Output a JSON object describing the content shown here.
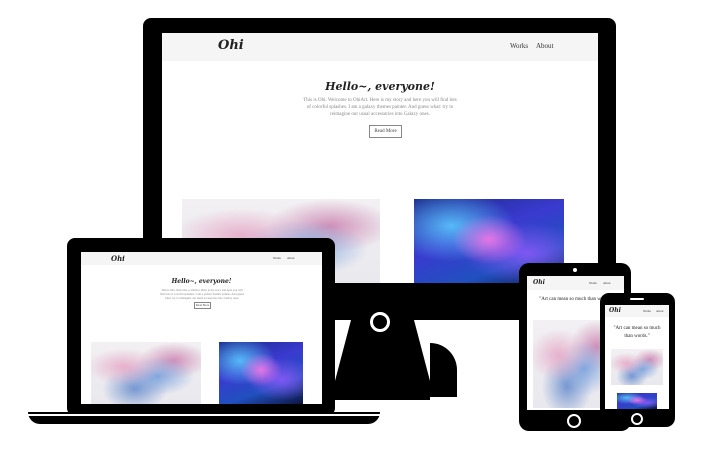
{
  "site": {
    "brand": "Ohi",
    "nav": [
      "Works",
      "About"
    ],
    "hero_title": "Hello~, everyone!",
    "hero_text": "This is Ohi. Welcome to OhiArt. Here is my story and here you will find lots of colorful splashes. I am a galaxy themes painter. And guess what: try to reimagine our usual accessories into Galaxy ones.",
    "button_label": "Read More",
    "quote": "\"Art can mean so much than words.\""
  },
  "colors": {
    "device_frame": "#000000",
    "screen_bg": "#ffffff",
    "header_bg": "#f5f5f5"
  },
  "artworks": [
    "flower-calligraphy-painting",
    "galaxy-forest-painting"
  ]
}
